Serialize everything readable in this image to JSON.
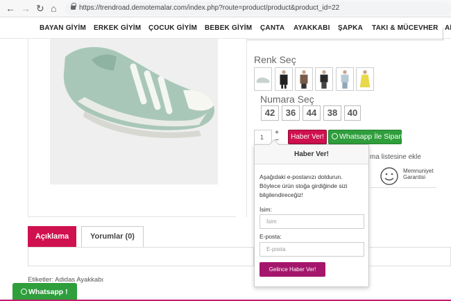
{
  "browser": {
    "url": "https://trendroad.demotemalar.com/index.php?route=product/product&product_id=22",
    "back_glyph": "←",
    "forward_glyph": "→",
    "reload_glyph": "↻",
    "home_glyph": "⌂"
  },
  "menu": {
    "items": [
      "BAYAN GİYİM",
      "ERKEK GİYİM",
      "ÇOCUK GİYİM",
      "BEBEK GİYİM",
      "ÇANTA",
      "AYAKKABI",
      "ŞAPKA",
      "TAKI & MÜCEVHER",
      "Ak"
    ]
  },
  "product": {
    "color_title": "Renk Seç",
    "size_title": "Numara Seç",
    "sizes": [
      "42",
      "36",
      "44",
      "38",
      "40"
    ],
    "quantity": "1",
    "plus": "+",
    "minus": "−",
    "notify_button": "Haber Ver!",
    "whatsapp_order": "Whatsapp İle Sipariş",
    "compare_text": "ma listesine ekle",
    "guarantee_line1": "Memnuniyet",
    "guarantee_line2": "Garantisi"
  },
  "popover": {
    "title": "Haber Ver!",
    "description": "Aşağıdaki e-postanızı doldurun. Böylece ürün stoğa girdiğinde sizi bilgilendireceğiz!",
    "name_label": "İsim:",
    "name_placeholder": "İsim",
    "email_label": "E-posta:",
    "email_placeholder": "E-posta",
    "submit": "Gelince Haber Ver!"
  },
  "tabs": {
    "description": "Açıklama",
    "reviews": "Yorumlar (0)"
  },
  "tags_text": "Etiketler: Adidas Ayakkabı",
  "whatsapp_float": "Whatsapp !",
  "colors": {
    "accent": "#d0114f",
    "whatsapp": "#2f9e3c",
    "submit": "#a4166c"
  }
}
